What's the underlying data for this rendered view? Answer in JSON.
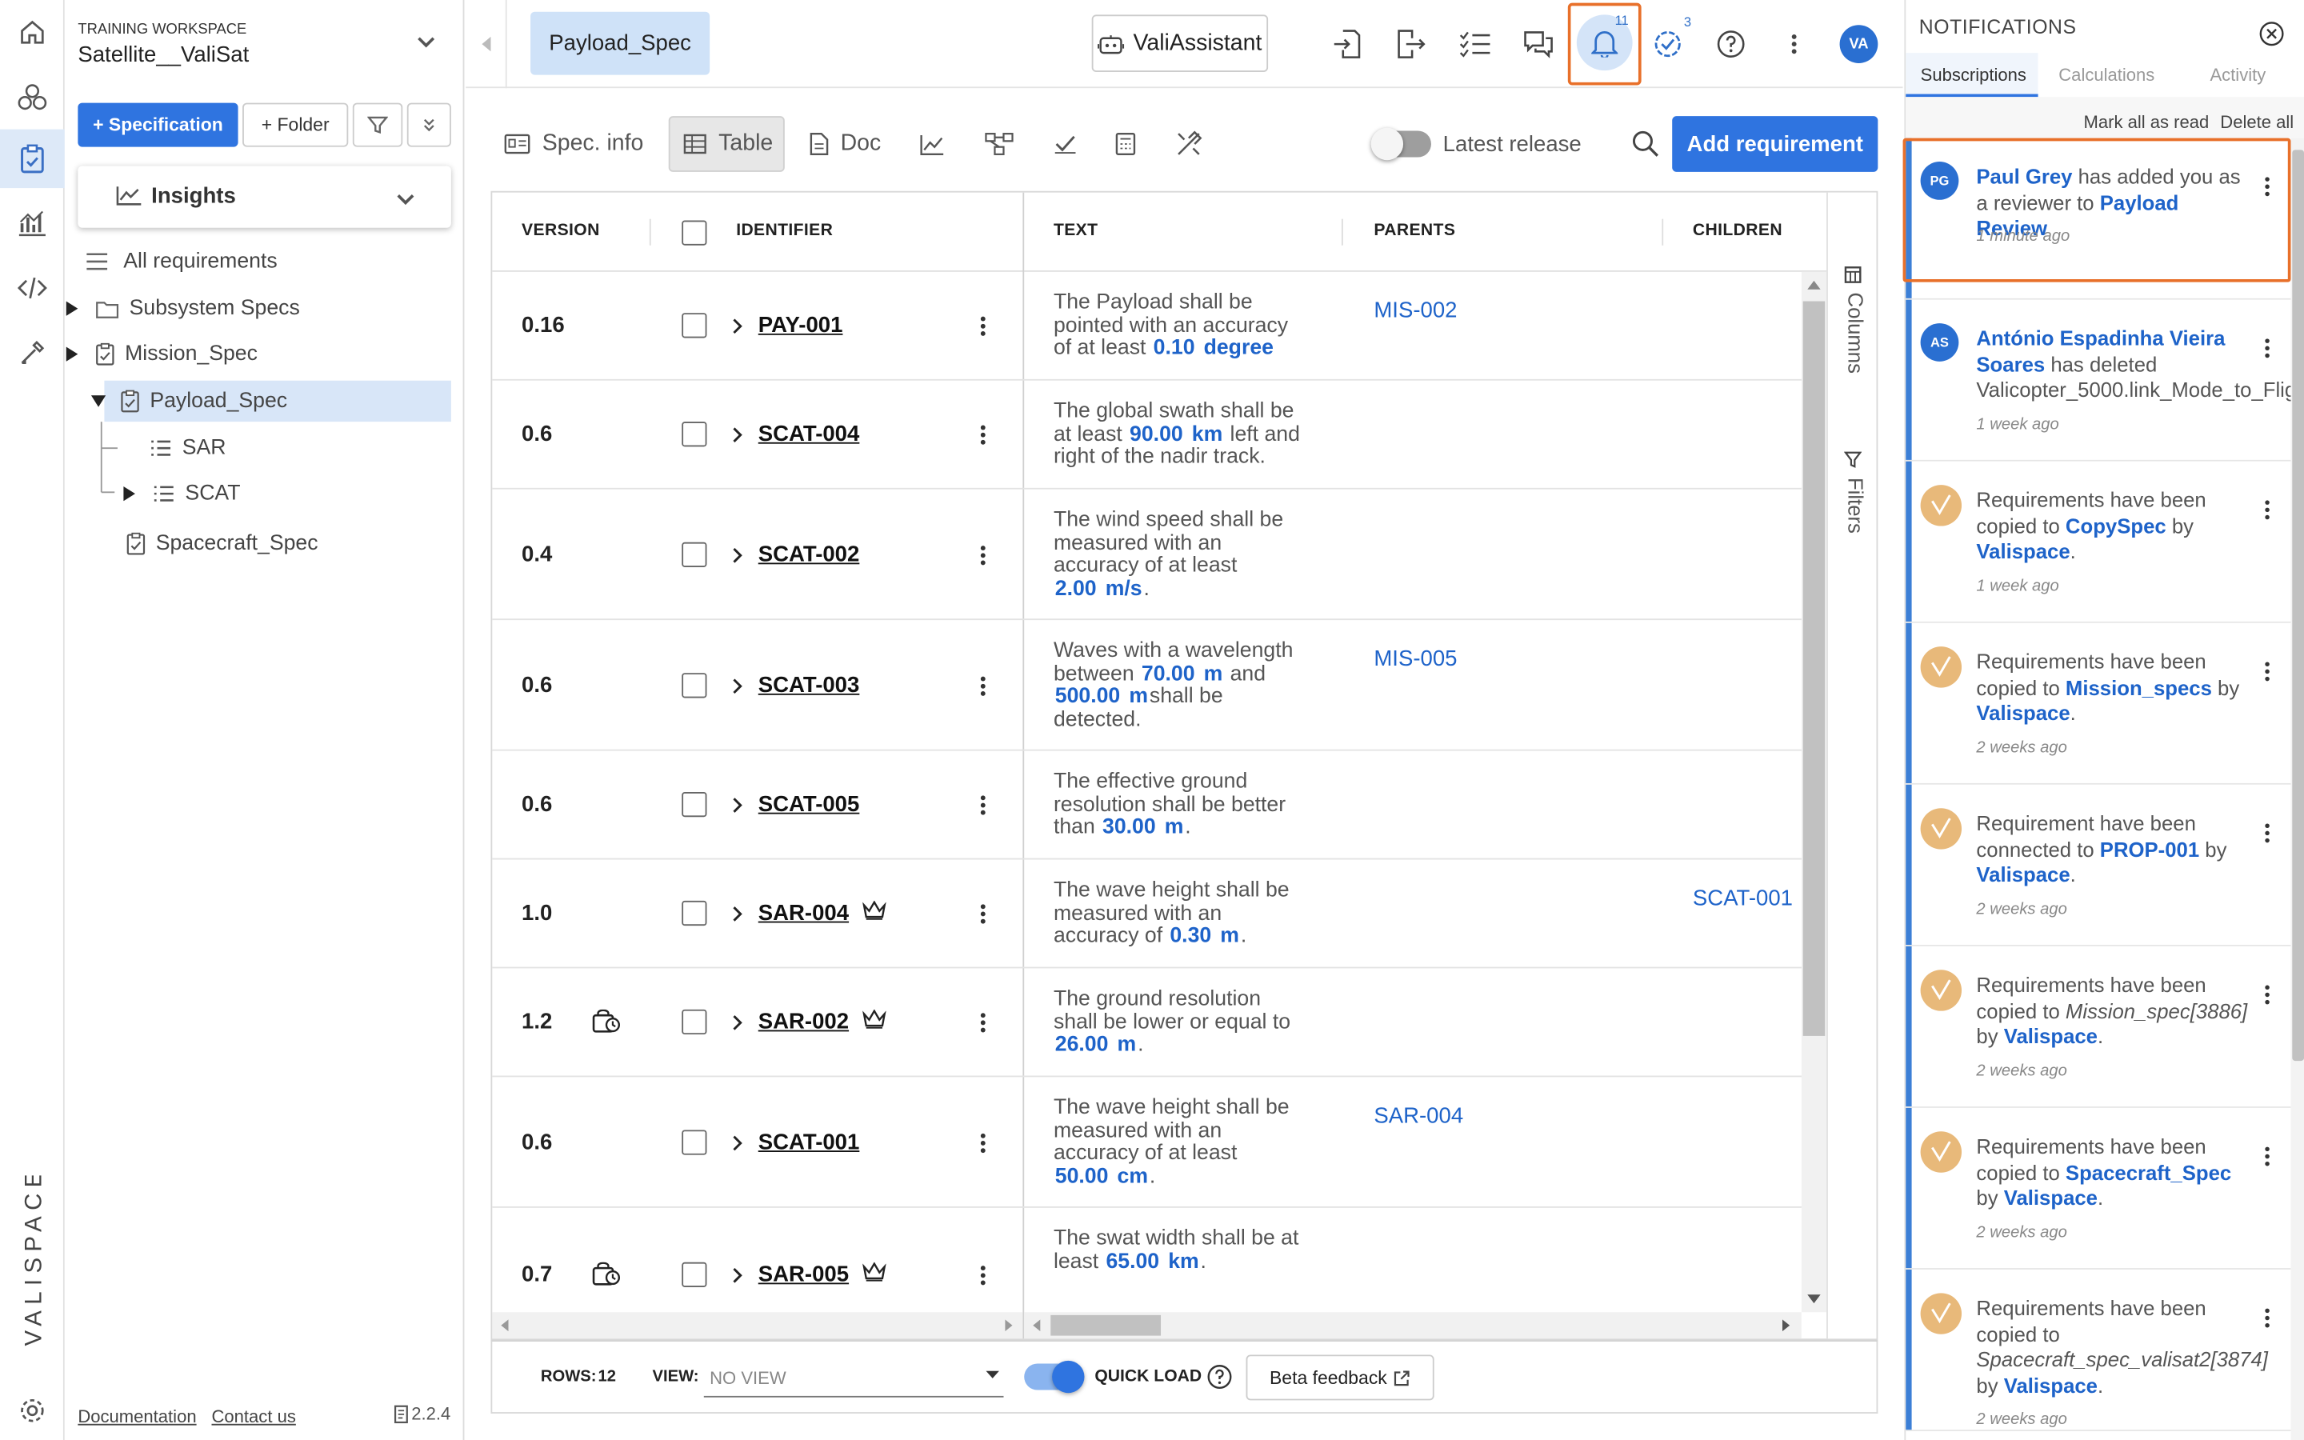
{
  "workspace": {
    "label": "TRAINING WORKSPACE",
    "name": "Satellite__ValiSat"
  },
  "left": {
    "spec_button": "+ Specification",
    "folder_button": "+ Folder",
    "insights": "Insights",
    "all_requirements": "All requirements",
    "tree": [
      {
        "label": "Subsystem Specs",
        "type": "folder"
      },
      {
        "label": "Mission_Spec",
        "type": "spec"
      },
      {
        "label": "Payload_Spec",
        "type": "spec",
        "selected": true
      },
      {
        "label": "SAR",
        "type": "list"
      },
      {
        "label": "SCAT",
        "type": "list"
      },
      {
        "label": "Spacecraft_Spec",
        "type": "spec"
      }
    ],
    "footer": {
      "documentation": "Documentation",
      "contact": "Contact us",
      "version": "2.2.4"
    },
    "brand": "VALISPACE"
  },
  "header": {
    "tab": "Payload_Spec",
    "assistant": "ValiAssistant",
    "bell_count": "11",
    "check_count": "3",
    "user_initials": "VA"
  },
  "toolbar": {
    "spec_info": "Spec. info",
    "table": "Table",
    "doc": "Doc",
    "latest_release": "Latest release",
    "add_requirement": "Add requirement"
  },
  "table": {
    "columns": [
      "VERSION",
      "IDENTIFIER",
      "TEXT",
      "PARENTS",
      "CHILDREN"
    ],
    "side_columns": "Columns",
    "side_filters": "Filters",
    "rows": [
      {
        "version": "0.16",
        "id": "PAY-001",
        "crown": false,
        "lock": false,
        "text": [
          "The Payload shall be",
          "pointed with an accuracy",
          "of at least "
        ],
        "v1": "0.10",
        "u1": "degree",
        "tail": "",
        "parents": "MIS-002",
        "children": ""
      },
      {
        "version": "0.6",
        "id": "SCAT-004",
        "crown": false,
        "lock": false,
        "text": [
          "The global swath shall be",
          "at least "
        ],
        "v1": "90.00",
        "u1": "km",
        "tail": " left and|right of the nadir track.",
        "parents": "",
        "children": ""
      },
      {
        "version": "0.4",
        "id": "SCAT-002",
        "crown": false,
        "lock": false,
        "text": [
          "The wind speed shall be",
          "measured with an",
          "accuracy of at least",
          ""
        ],
        "v1": "2.00",
        "u1": "m/s",
        "tail": ".",
        "parents": "",
        "children": ""
      },
      {
        "version": "0.6",
        "id": "SCAT-003",
        "crown": false,
        "lock": false,
        "text": [
          "Waves with a wavelength",
          "between "
        ],
        "v1": "70.00",
        "u1": "m",
        "tail": " and|",
        "v2": "500.00",
        "u2": "m",
        "tail2": "shall be|detected.",
        "parents": "MIS-005",
        "children": ""
      },
      {
        "version": "0.6",
        "id": "SCAT-005",
        "crown": false,
        "lock": false,
        "text": [
          "The effective ground",
          "resolution shall be better",
          "than "
        ],
        "v1": "30.00",
        "u1": "m",
        "tail": ".",
        "parents": "",
        "children": ""
      },
      {
        "version": "1.0",
        "id": "SAR-004",
        "crown": true,
        "lock": false,
        "text": [
          "The wave height shall be",
          "measured with an",
          "accuracy of "
        ],
        "v1": "0.30",
        "u1": "m",
        "tail": ".",
        "parents": "",
        "children": "SCAT-001"
      },
      {
        "version": "1.2",
        "id": "SAR-002",
        "crown": true,
        "lock": true,
        "text": [
          "The ground resolution",
          "shall be lower or equal to",
          ""
        ],
        "v1": "26.00",
        "u1": "m",
        "tail": ".",
        "parents": "",
        "children": ""
      },
      {
        "version": "0.6",
        "id": "SCAT-001",
        "crown": false,
        "lock": false,
        "text": [
          "The wave height shall be",
          "measured with an",
          "accuracy of at least",
          ""
        ],
        "v1": "50.00",
        "u1": "cm",
        "tail": ".",
        "parents": "SAR-004",
        "children": ""
      },
      {
        "version": "0.7",
        "id": "SAR-005",
        "crown": true,
        "lock": true,
        "text": [
          "The swat width shall be at",
          "least "
        ],
        "v1": "65.00",
        "u1": "km",
        "tail": ".",
        "parents": "",
        "children": ""
      }
    ]
  },
  "footer": {
    "rows_label": "ROWS:",
    "rows_value": "12",
    "view_label": "VIEW:",
    "view_placeholder": "NO VIEW",
    "quick_load": "QUICK LOAD",
    "beta": "Beta feedback"
  },
  "notifications": {
    "title": "NOTIFICATIONS",
    "tabs": [
      "Subscriptions",
      "Calculations",
      "Activity"
    ],
    "mark_all": "Mark all as read",
    "delete_all": "Delete all",
    "items": [
      {
        "avatar": "PG",
        "html": "<a>Paul Grey</a> has added you as a reviewer to <a>Payload Review</a>",
        "time": "1 minute ago",
        "lines": 2
      },
      {
        "avatar": "AS",
        "html": "<a>António Espadinha Vieira Soares</a> has deleted Valicopter_5000.link_Mode_to_Flig",
        "time": "1 week ago",
        "lines": 3
      },
      {
        "avatar": "",
        "html": "Requirements have been copied to <a>CopySpec</a> by <a>Valispace</a>.",
        "time": "1 week ago",
        "lines": 3
      },
      {
        "avatar": "",
        "html": "Requirements have been copied to <a>Mission_specs</a> by <a>Valispace</a>.",
        "time": "2 weeks ago",
        "lines": 3
      },
      {
        "avatar": "",
        "html": "Requirement have been connected to <a>PROP-001</a> by <a>Valispace</a>.",
        "time": "2 weeks ago",
        "lines": 3
      },
      {
        "avatar": "",
        "html": "Requirements have been copied to <i>Mission_spec[3886]</i> by <a>Valispace</a>.",
        "time": "2 weeks ago",
        "lines": 3
      },
      {
        "avatar": "",
        "html": "Requirements have been copied to <a>Spacecraft_Spec</a> by <a>Valispace</a>.",
        "time": "2 weeks ago",
        "lines": 3
      },
      {
        "avatar": "",
        "html": "Requirements have been copied to <i>Spacecraft_spec_valisat2[3874]</i> by <a>Valispace</a>.",
        "time": "2 weeks ago",
        "lines": 4
      }
    ]
  },
  "colors": {
    "primary": "#2f74e0",
    "highlight": "#e8702a",
    "link": "#1e63c9"
  }
}
